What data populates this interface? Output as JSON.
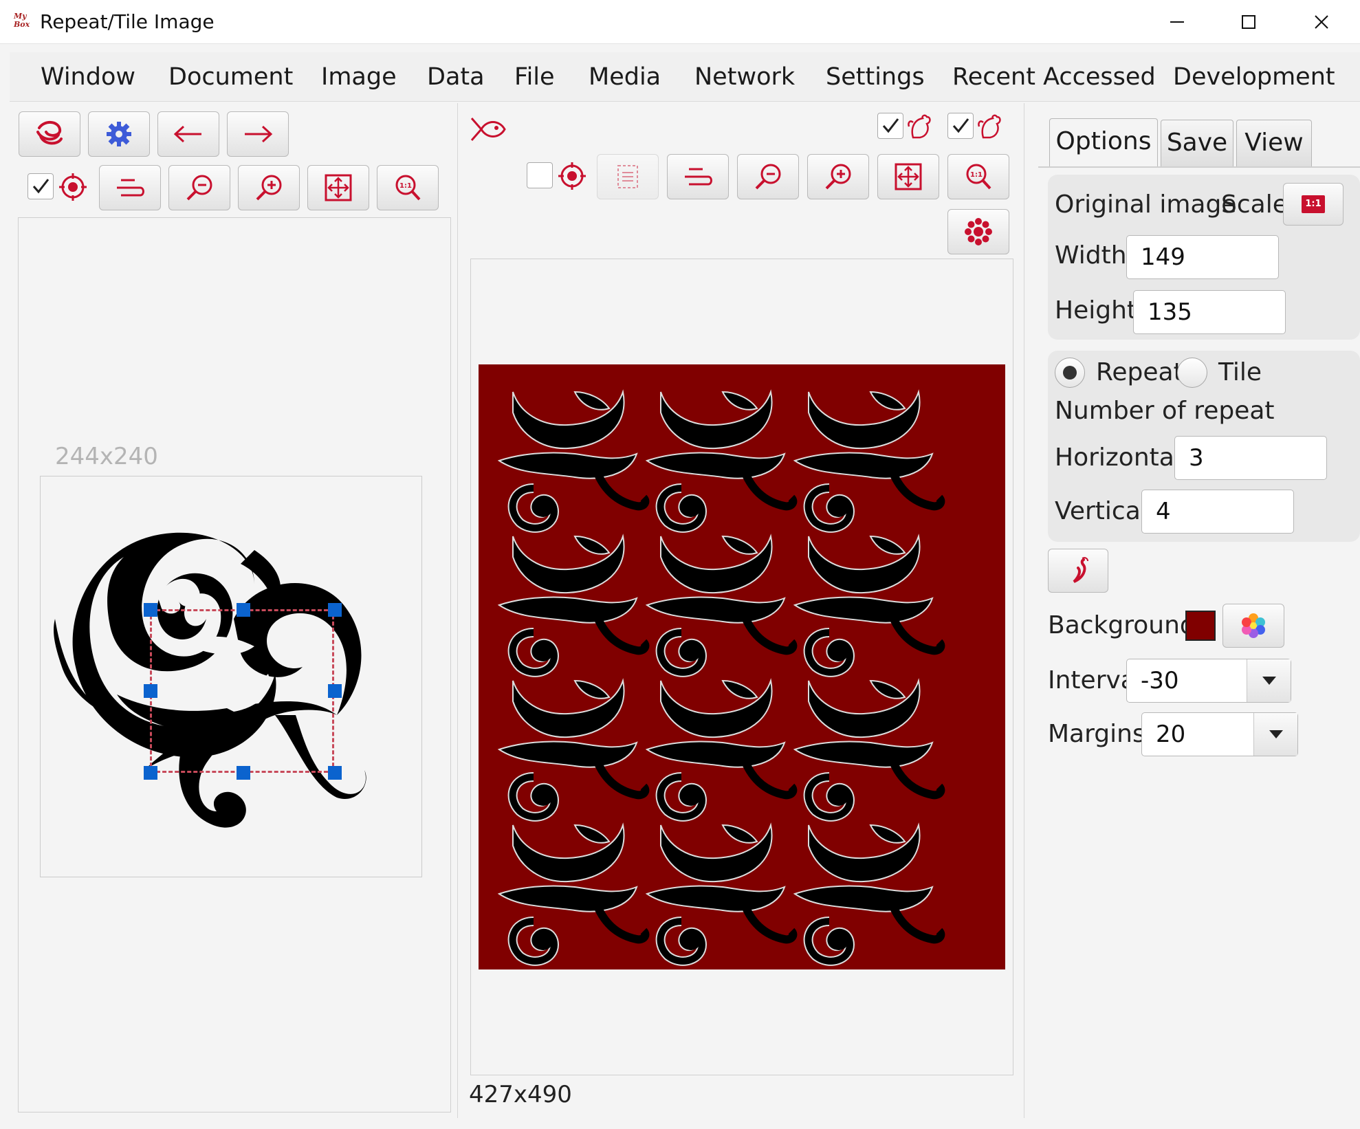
{
  "window": {
    "title": "Repeat/Tile Image",
    "logo_text": "My Box"
  },
  "menu": [
    "Window",
    "Document",
    "Image",
    "Data",
    "File",
    "Media",
    "Network",
    "Settings",
    "Recent Accessed",
    "Development"
  ],
  "source": {
    "dimensions": "244x240"
  },
  "result": {
    "dimensions": "427x490"
  },
  "tabs": [
    "Options",
    "Save",
    "View"
  ],
  "options": {
    "original_label": "Original image",
    "scale_label": "Scale",
    "scale_icon_text": "1:1",
    "width_label": "Width",
    "width_value": "149",
    "height_label": "Height",
    "height_value": "135",
    "mode_repeat": "Repeat",
    "mode_tile": "Tile",
    "mode_selected": "Repeat",
    "number_label": "Number of repeat",
    "horizontal_label": "Horizontal",
    "horizontal_value": "3",
    "vertical_label": "Vertical",
    "vertical_value": "4",
    "background_label": "Background",
    "background_color": "#800000",
    "interval_label": "Interval",
    "interval_value": "-30",
    "margins_label": "Margins",
    "margins_value": "20"
  },
  "colors": {
    "accent": "#c8102e",
    "selection": "#0b63ce",
    "crop_border": "#c84a5a"
  },
  "icons": [
    "myBox-logo-icon",
    "settings-gear-icon",
    "arrow-left-icon",
    "arrow-right-icon",
    "target-icon",
    "pan-icon",
    "zoom-out-icon",
    "zoom-in-icon",
    "fit-window-icon",
    "zoom-actual-icon",
    "fish-icon",
    "rooster-icon",
    "flower-icon",
    "pepper-icon",
    "palette-icon",
    "dropdown-arrow-icon"
  ]
}
